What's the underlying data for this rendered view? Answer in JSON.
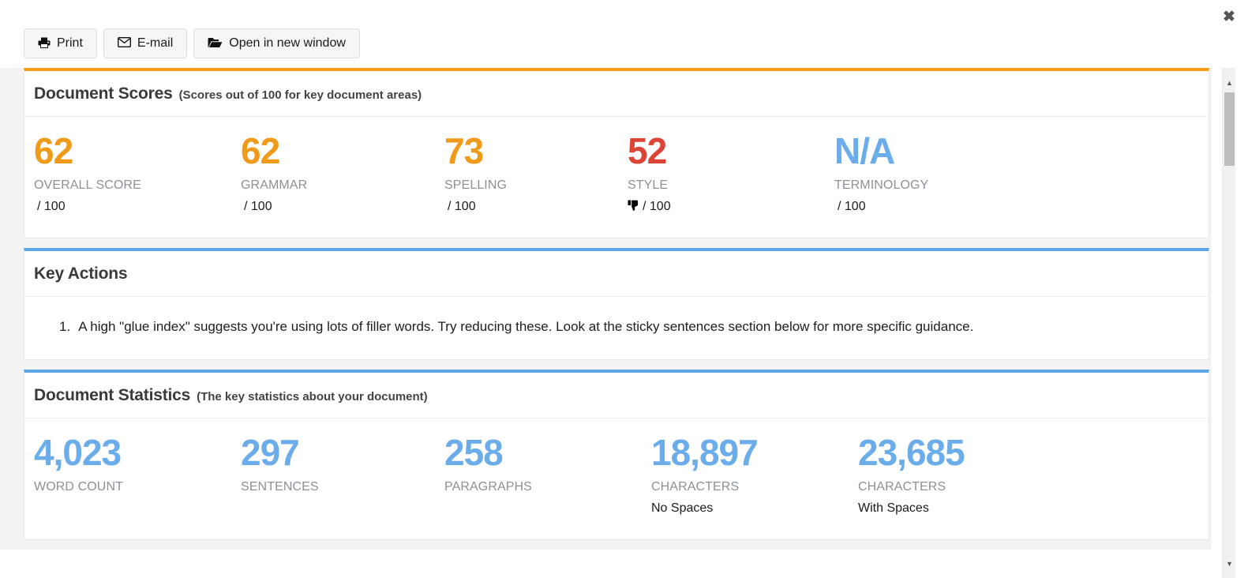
{
  "window": {
    "close_label": "✖"
  },
  "toolbar": {
    "buttons": [
      {
        "label": "Print",
        "icon": "printer-icon",
        "glyph": "🖶"
      },
      {
        "label": "E-mail",
        "icon": "envelope-icon",
        "glyph": "✉"
      },
      {
        "label": "Open in new window",
        "icon": "folder-open-icon",
        "glyph": "🗁"
      }
    ]
  },
  "sections": {
    "scores": {
      "title": "Document Scores",
      "subtitle": "(Scores out of 100 for key document areas)",
      "accent_color": "#f59d12",
      "metrics": [
        {
          "value": "62",
          "label": "OVERALL SCORE",
          "denom": "/ 100",
          "color": "#f09a1a",
          "flag": ""
        },
        {
          "value": "62",
          "label": "GRAMMAR",
          "denom": "/ 100",
          "color": "#f09a1a",
          "flag": ""
        },
        {
          "value": "73",
          "label": "SPELLING",
          "denom": "/ 100",
          "color": "#f09a1a",
          "flag": ""
        },
        {
          "value": "52",
          "label": "STYLE",
          "denom": "/ 100",
          "color": "#dc4436",
          "flag": "👎"
        },
        {
          "value": "N/A",
          "label": "TERMINOLOGY",
          "denom": "/ 100",
          "color": "#6bacea",
          "flag": ""
        }
      ]
    },
    "key_actions": {
      "title": "Key Actions",
      "accent_color": "#5ba7e5",
      "items": [
        {
          "number": "1.",
          "text": "A high \"glue index\" suggests you're using lots of filler words. Try reducing these. Look at the sticky sentences section below for more specific guidance."
        }
      ]
    },
    "statistics": {
      "title": "Document Statistics",
      "subtitle": "(The key statistics about your document)",
      "accent_color": "#5ba7e5",
      "metrics": [
        {
          "value": "4,023",
          "label": "WORD COUNT",
          "sub": ""
        },
        {
          "value": "297",
          "label": "SENTENCES",
          "sub": ""
        },
        {
          "value": "258",
          "label": "PARAGRAPHS",
          "sub": ""
        },
        {
          "value": "18,897",
          "label": "CHARACTERS",
          "sub": "No Spaces"
        },
        {
          "value": "23,685",
          "label": "CHARACTERS",
          "sub": "With Spaces"
        }
      ]
    }
  },
  "scrollbar": {
    "up_arrow": "▲",
    "down_arrow": "▼"
  }
}
